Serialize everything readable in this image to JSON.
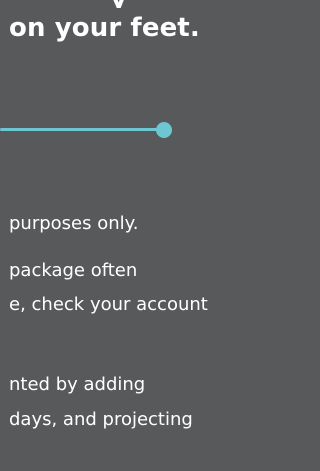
{
  "heading": {
    "clipped_line": "y",
    "line": "on your feet."
  },
  "progress": {
    "value_fraction": 1.0,
    "accent_color": "#6cc7d2"
  },
  "disclaimer": {
    "line1": "purposes only.",
    "line2a": "package often",
    "line2b": "e, check your account",
    "line3a": "nted by adding",
    "line3b": "days, and projecting"
  },
  "colors": {
    "background": "#57595b",
    "text": "#ffffff"
  }
}
